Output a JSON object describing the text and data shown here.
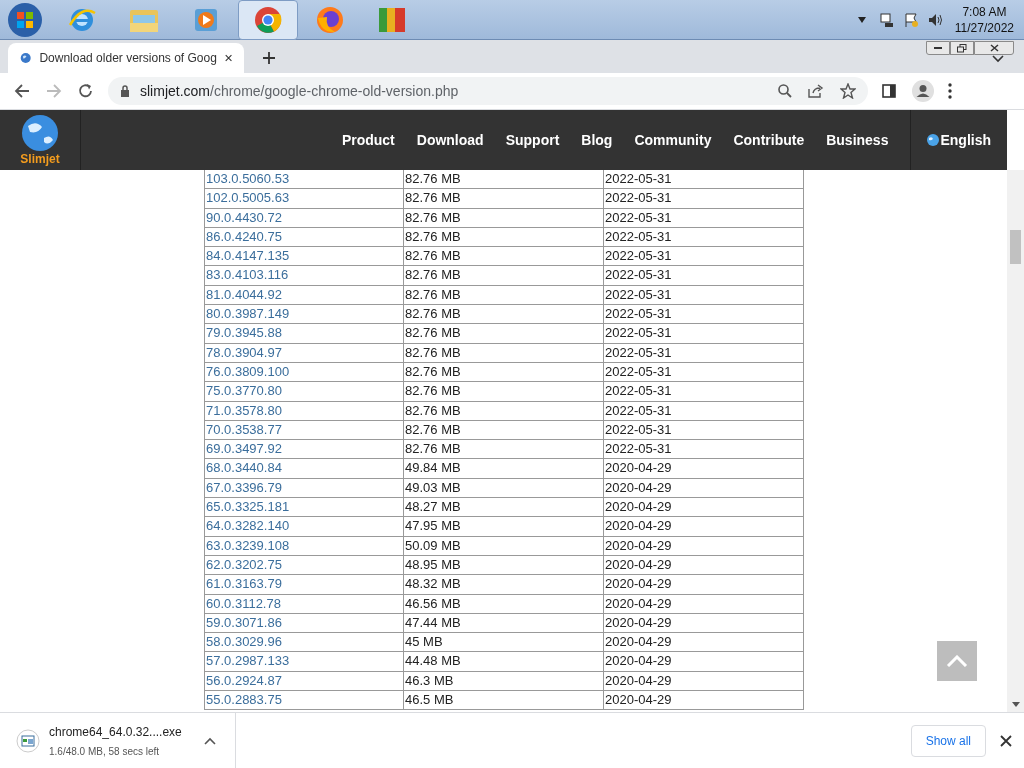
{
  "taskbar": {
    "apps": [
      {
        "kind": "ie",
        "selected": false
      },
      {
        "kind": "explorer",
        "selected": false
      },
      {
        "kind": "media",
        "selected": false
      },
      {
        "kind": "chrome",
        "selected": true
      },
      {
        "kind": "firefox",
        "selected": false
      },
      {
        "kind": "avg",
        "selected": false
      }
    ],
    "time": "7:08 AM",
    "date": "11/27/2022"
  },
  "tab": {
    "title": "Download older versions of Goog"
  },
  "address": {
    "domain": "slimjet.com",
    "path": "/chrome/google-chrome-old-version.php"
  },
  "site": {
    "logo": "Slimjet",
    "nav": [
      "Product",
      "Download",
      "Support",
      "Blog",
      "Community",
      "Contribute",
      "Business"
    ],
    "language": "English"
  },
  "rows": [
    [
      "103.0.5060.53",
      "82.76 MB",
      "2022-05-31"
    ],
    [
      "102.0.5005.63",
      "82.76 MB",
      "2022-05-31"
    ],
    [
      "90.0.4430.72",
      "82.76 MB",
      "2022-05-31"
    ],
    [
      "86.0.4240.75",
      "82.76 MB",
      "2022-05-31"
    ],
    [
      "84.0.4147.135",
      "82.76 MB",
      "2022-05-31"
    ],
    [
      "83.0.4103.116",
      "82.76 MB",
      "2022-05-31"
    ],
    [
      "81.0.4044.92",
      "82.76 MB",
      "2022-05-31"
    ],
    [
      "80.0.3987.149",
      "82.76 MB",
      "2022-05-31"
    ],
    [
      "79.0.3945.88",
      "82.76 MB",
      "2022-05-31"
    ],
    [
      "78.0.3904.97",
      "82.76 MB",
      "2022-05-31"
    ],
    [
      "76.0.3809.100",
      "82.76 MB",
      "2022-05-31"
    ],
    [
      "75.0.3770.80",
      "82.76 MB",
      "2022-05-31"
    ],
    [
      "71.0.3578.80",
      "82.76 MB",
      "2022-05-31"
    ],
    [
      "70.0.3538.77",
      "82.76 MB",
      "2022-05-31"
    ],
    [
      "69.0.3497.92",
      "82.76 MB",
      "2022-05-31"
    ],
    [
      "68.0.3440.84",
      "49.84 MB",
      "2020-04-29"
    ],
    [
      "67.0.3396.79",
      "49.03 MB",
      "2020-04-29"
    ],
    [
      "65.0.3325.181",
      "48.27 MB",
      "2020-04-29"
    ],
    [
      "64.0.3282.140",
      "47.95 MB",
      "2020-04-29"
    ],
    [
      "63.0.3239.108",
      "50.09 MB",
      "2020-04-29"
    ],
    [
      "62.0.3202.75",
      "48.95 MB",
      "2020-04-29"
    ],
    [
      "61.0.3163.79",
      "48.32 MB",
      "2020-04-29"
    ],
    [
      "60.0.3112.78",
      "46.56 MB",
      "2020-04-29"
    ],
    [
      "59.0.3071.86",
      "47.44 MB",
      "2020-04-29"
    ],
    [
      "58.0.3029.96",
      "45 MB",
      "2020-04-29"
    ],
    [
      "57.0.2987.133",
      "44.48 MB",
      "2020-04-29"
    ],
    [
      "56.0.2924.87",
      "46.3 MB",
      "2020-04-29"
    ],
    [
      "55.0.2883.75",
      "46.5 MB",
      "2020-04-29"
    ]
  ],
  "download": {
    "file": "chrome64_64.0.32....exe",
    "status": "1.6/48.0 MB, 58 secs left",
    "show_all": "Show all"
  }
}
